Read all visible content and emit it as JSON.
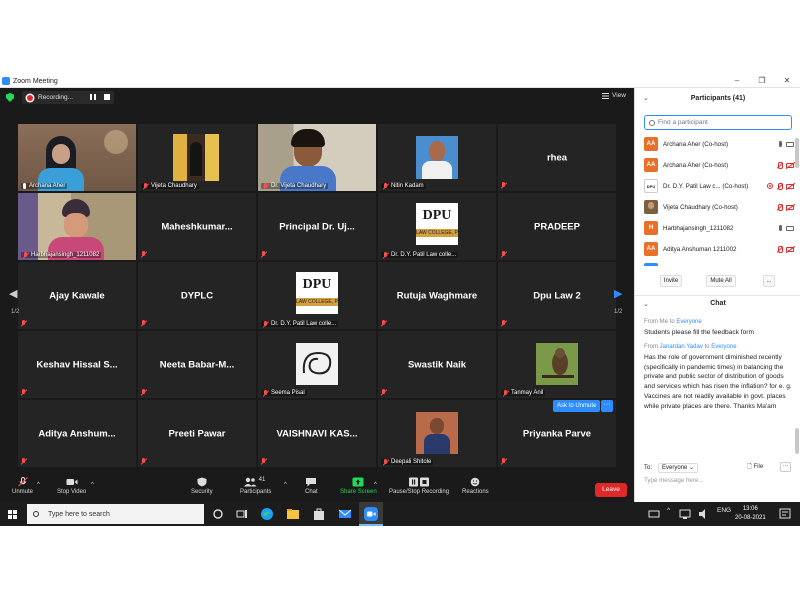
{
  "window": {
    "title": "Zoom Meeting"
  },
  "topbar": {
    "recording_label": "Recording...",
    "view_label": "View"
  },
  "tiles": [
    {
      "row": 0,
      "col": 0,
      "kind": "video",
      "name": "Archana Aher",
      "mic": "on",
      "active": true
    },
    {
      "row": 0,
      "col": 1,
      "kind": "video",
      "name": "Vijeta Chaudhary",
      "mic": "off"
    },
    {
      "row": 0,
      "col": 2,
      "kind": "video",
      "name": "Dr. Vijeta Chaudhary",
      "mic": "off"
    },
    {
      "row": 0,
      "col": 3,
      "kind": "photo",
      "name": "Nitin Kadam",
      "mic": "off"
    },
    {
      "row": 0,
      "col": 4,
      "kind": "name",
      "label": "rhea",
      "mic": "off"
    },
    {
      "row": 1,
      "col": 0,
      "kind": "video",
      "name": "Harbhajansingh_1211082",
      "mic": "off"
    },
    {
      "row": 1,
      "col": 1,
      "kind": "name",
      "label": "Maheshkumar...",
      "mic": "off"
    },
    {
      "row": 1,
      "col": 2,
      "kind": "name",
      "label": "Principal Dr. Uj...",
      "mic": "off"
    },
    {
      "row": 1,
      "col": 3,
      "kind": "logo",
      "name": "Dr. D.Y. Patil Law colle...",
      "mic": "off"
    },
    {
      "row": 1,
      "col": 4,
      "kind": "name",
      "label": "PRADEEP",
      "mic": "off"
    },
    {
      "row": 2,
      "col": 0,
      "kind": "name",
      "label": "Ajay Kawale",
      "mic": "off"
    },
    {
      "row": 2,
      "col": 1,
      "kind": "name",
      "label": "DYPLC",
      "mic": "off"
    },
    {
      "row": 2,
      "col": 2,
      "kind": "logo",
      "name": "Dr. D.Y. Patil Law colle...",
      "mic": "off"
    },
    {
      "row": 2,
      "col": 3,
      "kind": "name",
      "label": "Rutuja Waghmare",
      "mic": "off"
    },
    {
      "row": 2,
      "col": 4,
      "kind": "name",
      "label": "Dpu Law 2",
      "mic": "off"
    },
    {
      "row": 3,
      "col": 0,
      "kind": "name",
      "label": "Keshav Hissal S...",
      "mic": "off"
    },
    {
      "row": 3,
      "col": 1,
      "kind": "name",
      "label": "Neeta Babar-M...",
      "mic": "off"
    },
    {
      "row": 3,
      "col": 2,
      "kind": "sketch",
      "name": "Seema Pisal",
      "mic": "off"
    },
    {
      "row": 3,
      "col": 3,
      "kind": "name",
      "label": "Swastik Naik",
      "mic": "off"
    },
    {
      "row": 3,
      "col": 4,
      "kind": "bird",
      "name": "Tanmay Anil",
      "mic": "off"
    },
    {
      "row": 4,
      "col": 0,
      "kind": "name",
      "label": "Aditya Anshum...",
      "mic": "off"
    },
    {
      "row": 4,
      "col": 1,
      "kind": "name",
      "label": "Preeti Pawar",
      "mic": "off"
    },
    {
      "row": 4,
      "col": 2,
      "kind": "name",
      "label": "VAISHNAVI KAS...",
      "mic": "off"
    },
    {
      "row": 4,
      "col": 3,
      "kind": "photo2",
      "name": "Deepali Shitole",
      "mic": "off"
    },
    {
      "row": 4,
      "col": 4,
      "kind": "name",
      "label": "Priyanka Parve",
      "mic": "off"
    }
  ],
  "logo_text": {
    "line1": "DPU",
    "line2": "LAW COLLEGE, P"
  },
  "pager": {
    "left": "1/2",
    "right": "1/2"
  },
  "ask_to_unmute": {
    "label": "Ask to Unmute",
    "more": "···"
  },
  "toolbar": {
    "unmute": "Unmute",
    "stop_video": "Stop Video",
    "security": "Security",
    "participants": "Participants",
    "participants_count": "41",
    "chat": "Chat",
    "share_screen": "Share Screen",
    "pause_stop_recording": "Pause/Stop Recording",
    "reactions": "Reactions",
    "leave": "Leave"
  },
  "participants_panel": {
    "title": "Participants (41)",
    "search_placeholder": "Find a participant",
    "list": [
      {
        "initials": "AA",
        "avatar_color": "#e8702a",
        "name": "Archana Aher (Co-host)",
        "mic": "on",
        "cam": "on"
      },
      {
        "initials": "AA",
        "avatar_color": "#e8702a",
        "name": "Archana Aher (Co-host)",
        "mic": "off",
        "cam": "off"
      },
      {
        "initials": "",
        "avatar_color": "#ffffff",
        "name": "Dr. D.Y. Patil Law c...  (Co-host)",
        "mic": "off",
        "cam": "off",
        "rec": true,
        "logo": true
      },
      {
        "initials": "",
        "avatar_color": "#7a6040",
        "name": "Vijeta Chaudhary (Co-host)",
        "mic": "off",
        "cam": "off"
      },
      {
        "initials": "H",
        "avatar_color": "#e8702a",
        "name": "Harbhajansingh_1211082",
        "mic": "on",
        "cam": "on"
      },
      {
        "initials": "AA",
        "avatar_color": "#e8702a",
        "name": "Aditya Anshuman 1211002",
        "mic": "off",
        "cam": "off"
      }
    ],
    "invite": "Invite",
    "mute_all": "Mute All",
    "more": "..."
  },
  "chat_panel": {
    "title": "Chat",
    "messages": [
      {
        "from": "Me",
        "to": "Everyone",
        "text": "Students please fill the feedback form"
      },
      {
        "from": "Janardan Yadav",
        "to": "Everyone",
        "text": "Has the role of government diminished recently (specifically in pandemic times) in balancing the private and public sector of distribution of goods and services which has risen the inflation? for e. g. Vaccines are not readily available in govt. places while private places are there. Thanks Ma'am"
      }
    ],
    "meta_from": "From",
    "meta_to": "to",
    "to_label": "To:",
    "to_value": "Everyone",
    "file": "File",
    "more": "···",
    "input_placeholder": "Type message here..."
  },
  "taskbar": {
    "search_placeholder": "Type here to search",
    "language": "ENG",
    "time": "13:06",
    "date": "20-08-2021"
  },
  "colors": {
    "accent": "#2d8cff",
    "danger": "#e02828",
    "active_border": "#d8e84a",
    "recording_green": "#23d959"
  }
}
